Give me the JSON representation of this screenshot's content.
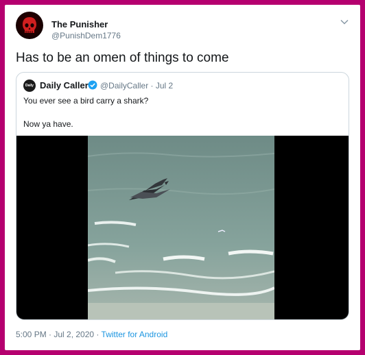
{
  "tweet": {
    "author_name": "The Punisher",
    "author_handle": "@PunishDem1776",
    "text": "Has to be an omen of things to come",
    "timestamp": "5:00 PM · Jul 2, 2020 ·",
    "client": "Twitter for Android"
  },
  "quoted_tweet": {
    "author_name": "Daily Caller",
    "author_handle_date": "@DailyCaller · Jul 2",
    "avatar_text": "Daily Caller",
    "line1": "You ever see a bird carry a shark?",
    "line2": "Now ya have."
  },
  "colors": {
    "border": "#b5006f",
    "link": "#1b95e0",
    "verified": "#1da1f2",
    "secondary_text": "#657786"
  }
}
